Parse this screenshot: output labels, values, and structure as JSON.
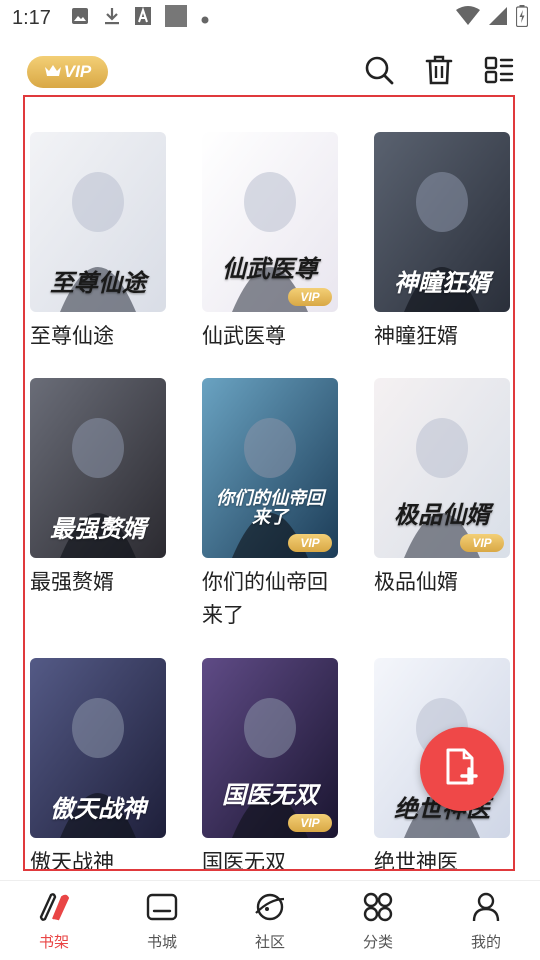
{
  "status_bar": {
    "time": "1:17",
    "icons_left": [
      "image-icon",
      "download-icon",
      "a-letter-icon",
      "square-icon",
      "dot-icon"
    ],
    "icons_right": [
      "wifi-icon",
      "signal-icon",
      "battery-icon"
    ]
  },
  "header": {
    "vip_label": "VIP",
    "buttons": [
      "search-icon",
      "trash-icon",
      "list-view-icon"
    ]
  },
  "books": [
    {
      "title": "至尊仙途",
      "vip": false,
      "palette": [
        "#d9dde6",
        "#f2f3f6"
      ],
      "cover_text": "至尊仙途"
    },
    {
      "title": "仙武医尊",
      "vip": true,
      "palette": [
        "#e9e6ef",
        "#ffffff"
      ],
      "cover_text": "仙武医尊"
    },
    {
      "title": "神瞳狂婿",
      "vip": false,
      "palette": [
        "#2a2f3a",
        "#5a6270"
      ],
      "cover_text": "神瞳狂婿"
    },
    {
      "title": "最强赘婿",
      "vip": false,
      "palette": [
        "#2b2a30",
        "#6a6d78"
      ],
      "cover_text": "最强赘婿"
    },
    {
      "title": "你们的仙帝回来了",
      "vip": true,
      "palette": [
        "#1c3c57",
        "#6aa3c2"
      ],
      "cover_text": "你们的仙帝回来了"
    },
    {
      "title": "极品仙婿",
      "vip": true,
      "palette": [
        "#d9dfe8",
        "#f5f1f2"
      ],
      "cover_text": "极品仙婿"
    },
    {
      "title": "傲天战神",
      "vip": false,
      "palette": [
        "#1e1f3a",
        "#545a86"
      ],
      "cover_text": "傲天战神"
    },
    {
      "title": "国医无双",
      "vip": true,
      "palette": [
        "#1a1530",
        "#5f4b86"
      ],
      "cover_text": "国医无双"
    },
    {
      "title": "绝世神医",
      "vip": false,
      "palette": [
        "#cfd6e6",
        "#f4f6fb"
      ],
      "cover_text": "绝世神医"
    }
  ],
  "fab": {
    "icon": "add-file-icon"
  },
  "colors": {
    "accent": "#e94545",
    "vip_gold": "#d9a845",
    "frame": "#e0393c"
  },
  "nav": [
    {
      "label": "书架",
      "icon": "bookshelf-icon",
      "active": true
    },
    {
      "label": "书城",
      "icon": "bookstore-icon",
      "active": false
    },
    {
      "label": "社区",
      "icon": "community-icon",
      "active": false
    },
    {
      "label": "分类",
      "icon": "category-icon",
      "active": false
    },
    {
      "label": "我的",
      "icon": "profile-icon",
      "active": false
    }
  ]
}
